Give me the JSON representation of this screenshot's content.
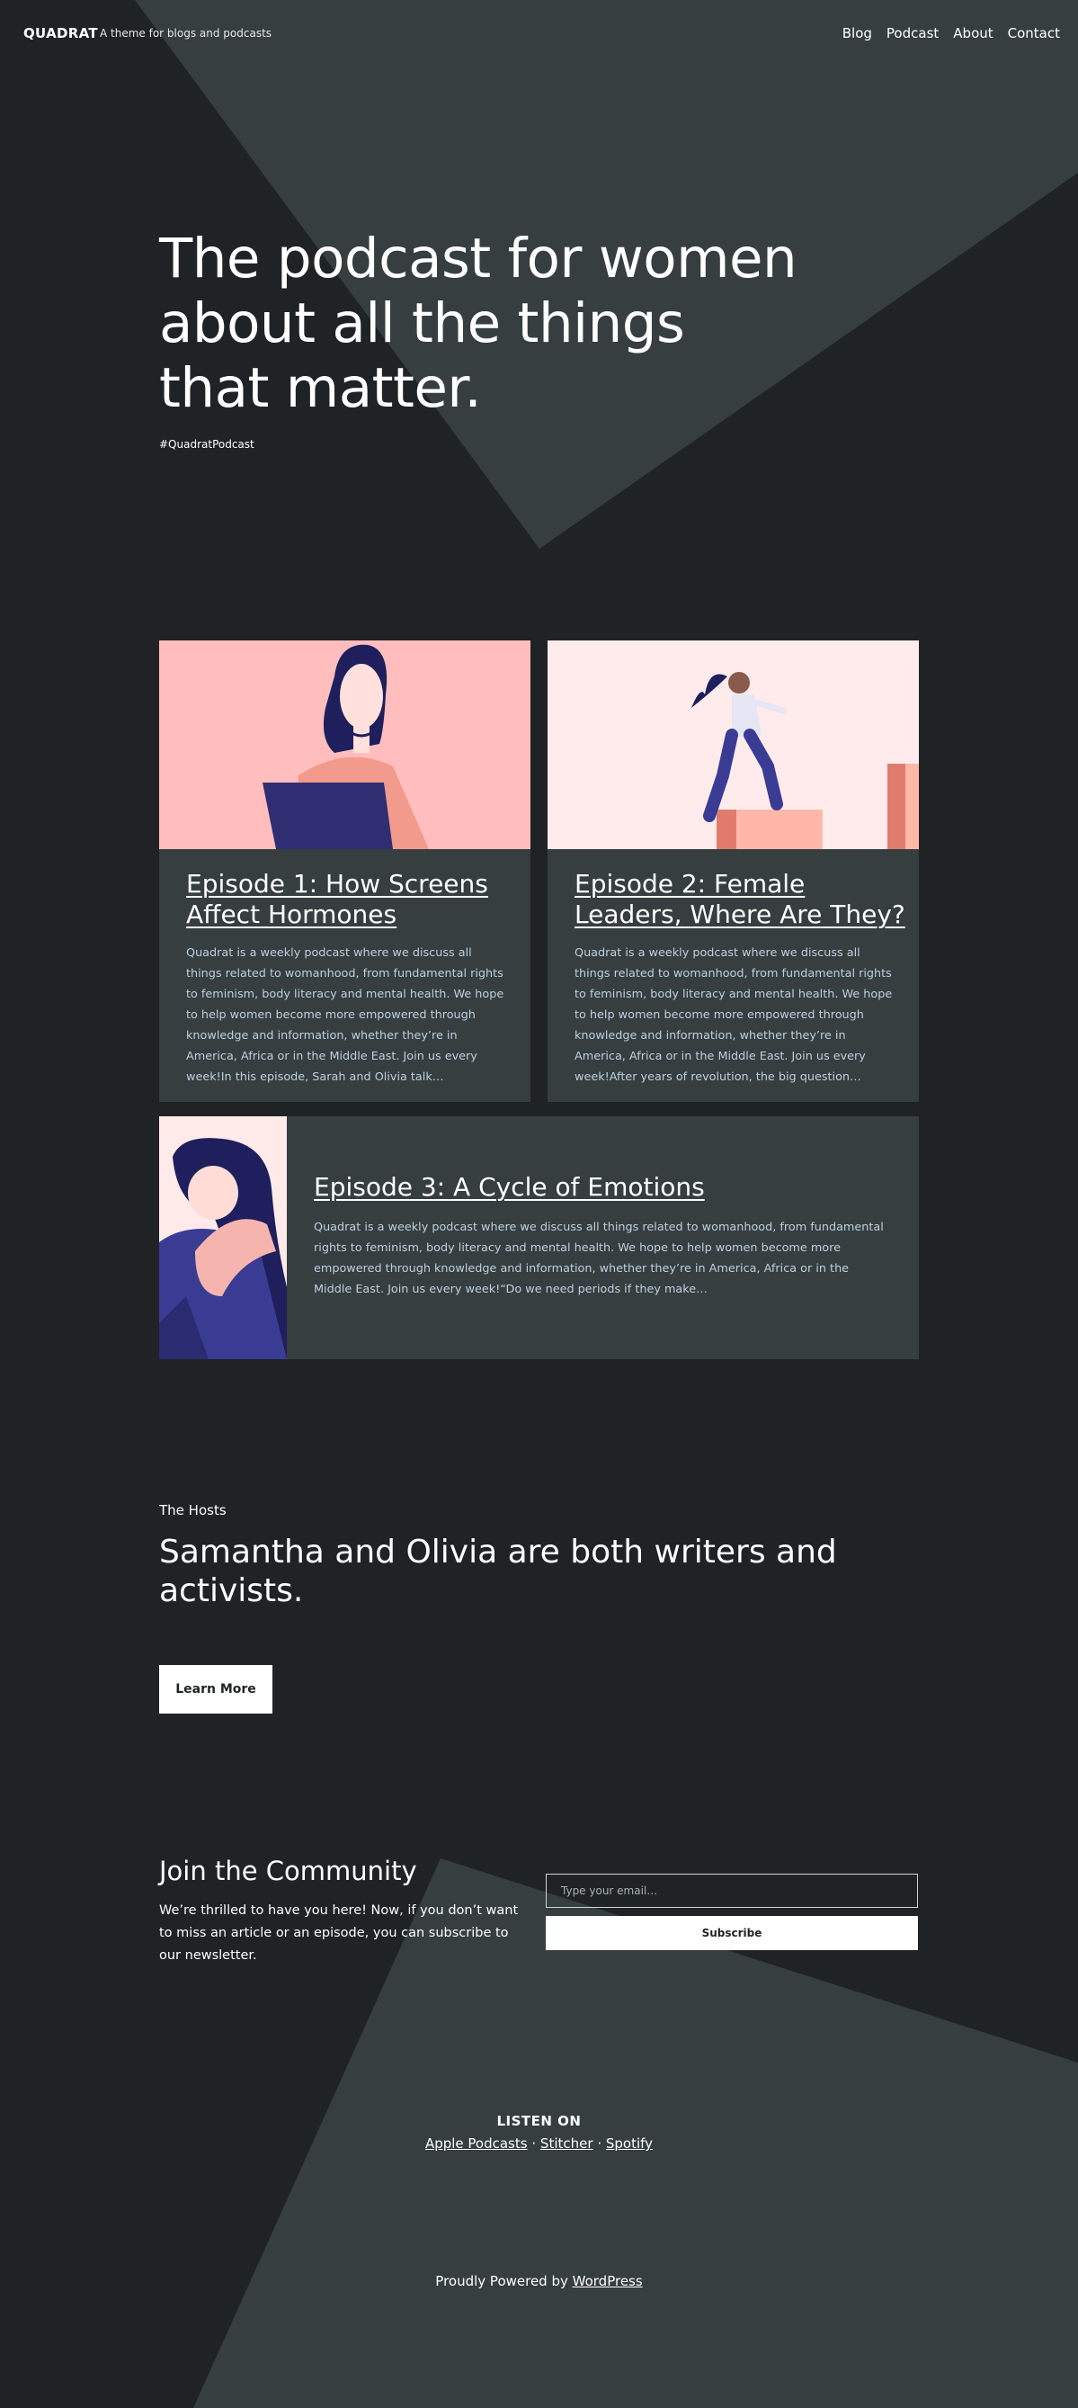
{
  "header": {
    "site_title": "QUADRAT",
    "tagline": "A theme for blogs and podcasts",
    "nav": [
      "Blog",
      "Podcast",
      "About",
      "Contact"
    ]
  },
  "hero": {
    "title": "The podcast for women about all the things that matter.",
    "hashtag": "#QuadratPodcast"
  },
  "episodes": [
    {
      "title": "Episode 1: How Screens Affect Hormones",
      "excerpt": "Quadrat is a weekly podcast where we discuss all things related to womanhood, from fundamental rights to feminism, body literacy and mental health. We hope to help women become more empowered through knowledge and information, whether they’re in America, Africa or in the Middle East. Join us every week!In this episode, Sarah and Olivia talk…"
    },
    {
      "title": "Episode 2: Female Leaders, Where Are They?",
      "excerpt": "Quadrat is a weekly podcast where we discuss all things related to womanhood, from fundamental rights to feminism, body literacy and mental health. We hope to help women become more empowered through knowledge and information, whether they’re in America, Africa or in the Middle East. Join us every week!After years of revolution, the big question…"
    },
    {
      "title": "Episode 3: A Cycle of Emotions",
      "excerpt": "Quadrat is a weekly podcast where we discuss all things related to womanhood, from fundamental rights to feminism, body literacy and mental health. We hope to help women become more empowered through knowledge and information, whether they’re in America, Africa or in the Middle East. Join us every week!“Do we need periods if they make…"
    }
  ],
  "hosts": {
    "kicker": "The Hosts",
    "title": "Samantha and Olivia are both writers and activists.",
    "button": "Learn More"
  },
  "community": {
    "title": "Join the Community",
    "text": "We’re thrilled to have you here! Now, if you don’t want to miss an article or an episode, you can subscribe to our newsletter.",
    "email_placeholder": "Type your email…",
    "subscribe": "Subscribe"
  },
  "listen": {
    "label": "LISTEN ON",
    "links": [
      "Apple Podcasts",
      "Stitcher",
      "Spotify"
    ],
    "separator": "·"
  },
  "footer": {
    "prefix": "Proudly Powered by ",
    "link": "WordPress"
  },
  "colors": {
    "background": "#1f2325",
    "shape": "#363e3f",
    "card": "#363e3f",
    "excerpt_text": "#bcd0e2",
    "pink": "#ffbdbd",
    "navy": "#1e1f5c",
    "indigo": "#3a3c94"
  }
}
